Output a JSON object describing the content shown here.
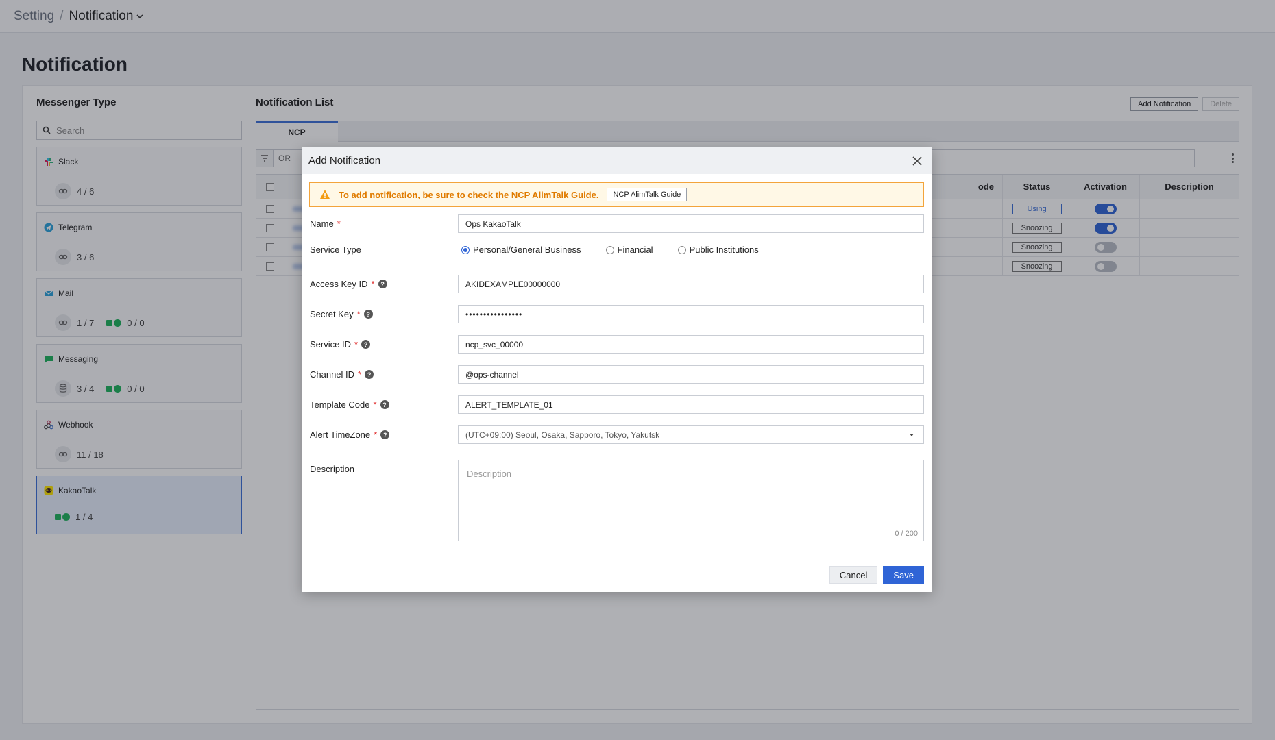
{
  "breadcrumb": {
    "root": "Setting",
    "separator": "/",
    "current": "Notification"
  },
  "page_title": "Notification",
  "left": {
    "title": "Messenger Type",
    "search_placeholder": "Search",
    "messengers": [
      {
        "name": "Slack",
        "icon": "slack-icon",
        "stats": [
          {
            "icon": "link-icon",
            "value": "4 / 6"
          }
        ]
      },
      {
        "name": "Telegram",
        "icon": "telegram-icon",
        "stats": [
          {
            "icon": "link-icon",
            "value": "3 / 6"
          }
        ]
      },
      {
        "name": "Mail",
        "icon": "mail-icon",
        "stats": [
          {
            "icon": "link-icon",
            "value": "1 / 7"
          },
          {
            "icon": "ncp-icon",
            "value": "0 / 0"
          }
        ]
      },
      {
        "name": "Messaging",
        "icon": "messaging-icon",
        "stats": [
          {
            "icon": "database-icon",
            "value": "3 / 4"
          },
          {
            "icon": "ncp-icon",
            "value": "0 / 0"
          }
        ]
      },
      {
        "name": "Webhook",
        "icon": "webhook-icon",
        "stats": [
          {
            "icon": "link-icon",
            "value": "11 / 18"
          }
        ]
      },
      {
        "name": "KakaoTalk",
        "icon": "kakaotalk-icon",
        "stats": [
          {
            "icon": "ncp-icon",
            "value": "1 / 4"
          }
        ]
      }
    ]
  },
  "right": {
    "title": "Notification List",
    "add_button": "Add Notification",
    "delete_button": "Delete",
    "tab": "NCP",
    "filter_operator": "OR",
    "columns": {
      "code": "ode",
      "status": "Status",
      "activation": "Activation",
      "description": "Description"
    },
    "rows": [
      {
        "status": "Using",
        "active": true
      },
      {
        "status": "Snoozing",
        "active": true
      },
      {
        "status": "Snoozing",
        "active": false
      },
      {
        "status": "Snoozing",
        "active": false
      }
    ]
  },
  "modal": {
    "title": "Add Notification",
    "alert_text": "To add notification, be sure to check the NCP AlimTalk Guide.",
    "guide_button": "NCP AlimTalk Guide",
    "fields": {
      "name": {
        "label": "Name",
        "value": "Ops KakaoTalk"
      },
      "service_type": {
        "label": "Service Type",
        "options": [
          "Personal/General Business",
          "Financial",
          "Public Institutions"
        ],
        "selected": "Personal/General Business"
      },
      "access_key": {
        "label": "Access Key ID",
        "value": "AKIDEXAMPLE00000000"
      },
      "secret_key": {
        "label": "Secret Key",
        "value": "••••••••••••••••"
      },
      "service_id": {
        "label": "Service ID",
        "value": "ncp_svc_00000"
      },
      "channel_id": {
        "label": "Channel ID",
        "value": "@ops-channel"
      },
      "template_code": {
        "label": "Template Code",
        "value": "ALERT_TEMPLATE_01"
      },
      "timezone": {
        "label": "Alert TimeZone",
        "value": "(UTC+09:00) Seoul, Osaka, Sapporo, Tokyo, Yakutsk"
      },
      "description": {
        "label": "Description",
        "placeholder": "Description",
        "counter": "0 / 200"
      }
    },
    "cancel_button": "Cancel",
    "save_button": "Save"
  },
  "colors": {
    "accent": "#2f64d6",
    "warning": "#e07b00",
    "required": "#e03030",
    "ncp_green": "#1db35b"
  }
}
